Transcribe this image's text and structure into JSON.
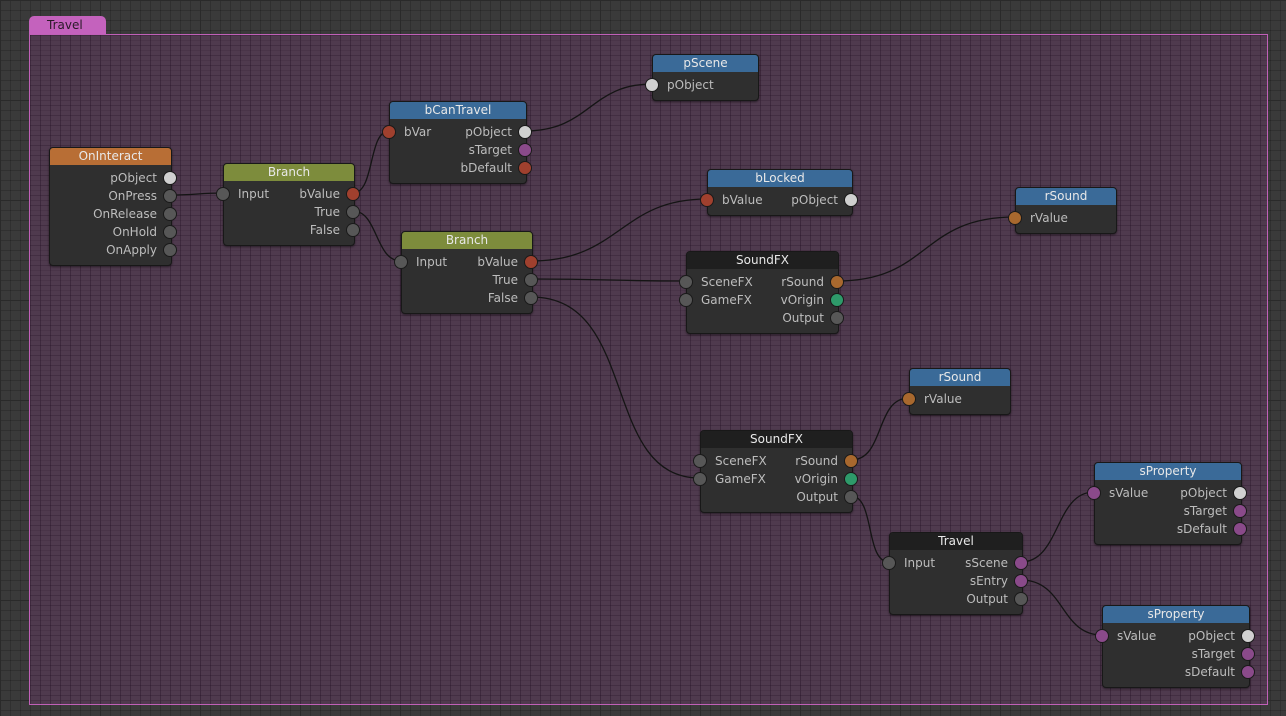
{
  "group": {
    "title": "Travel"
  },
  "nodes": {
    "oninteract": {
      "title": "OnInteract",
      "pins": [
        "pObject",
        "OnPress",
        "OnRelease",
        "OnHold",
        "OnApply"
      ]
    },
    "branch1": {
      "title": "Branch",
      "input": "Input",
      "outputs": [
        "bValue",
        "True",
        "False"
      ]
    },
    "bcantravel": {
      "title": "bCanTravel",
      "input": "bVar",
      "outputs": [
        "pObject",
        "sTarget",
        "bDefault"
      ]
    },
    "pscene": {
      "title": "pScene",
      "input": "pObject"
    },
    "branch2": {
      "title": "Branch",
      "input": "Input",
      "outputs": [
        "bValue",
        "True",
        "False"
      ]
    },
    "blocked": {
      "title": "bLocked",
      "input": "bValue",
      "output": "pObject"
    },
    "rsound1": {
      "title": "rSound",
      "input": "rValue"
    },
    "soundfx1": {
      "title": "SoundFX",
      "inputs": [
        "SceneFX",
        "GameFX"
      ],
      "outputs": [
        "rSound",
        "vOrigin",
        "Output"
      ]
    },
    "rsound2": {
      "title": "rSound",
      "input": "rValue"
    },
    "soundfx2": {
      "title": "SoundFX",
      "inputs": [
        "SceneFX",
        "GameFX"
      ],
      "outputs": [
        "rSound",
        "vOrigin",
        "Output"
      ]
    },
    "sproperty1": {
      "title": "sProperty",
      "input": "sValue",
      "outputs": [
        "pObject",
        "sTarget",
        "sDefault"
      ]
    },
    "travel": {
      "title": "Travel",
      "input": "Input",
      "outputs": [
        "sScene",
        "sEntry",
        "Output"
      ]
    },
    "sproperty2": {
      "title": "sProperty",
      "input": "sValue",
      "outputs": [
        "pObject",
        "sTarget",
        "sDefault"
      ]
    }
  },
  "colors": {
    "group_border": "#c060b8",
    "header_blue": "#3a6a98",
    "header_olive": "#7d8c3c",
    "header_orange": "#b86e35",
    "header_dark": "#1f1f1f",
    "pin_white": "#d0d0d0",
    "pin_gray": "#575757",
    "pin_red": "#a0402e",
    "pin_purple": "#8a4a8a",
    "pin_amber": "#a8682e",
    "pin_green": "#2e9a6a"
  }
}
